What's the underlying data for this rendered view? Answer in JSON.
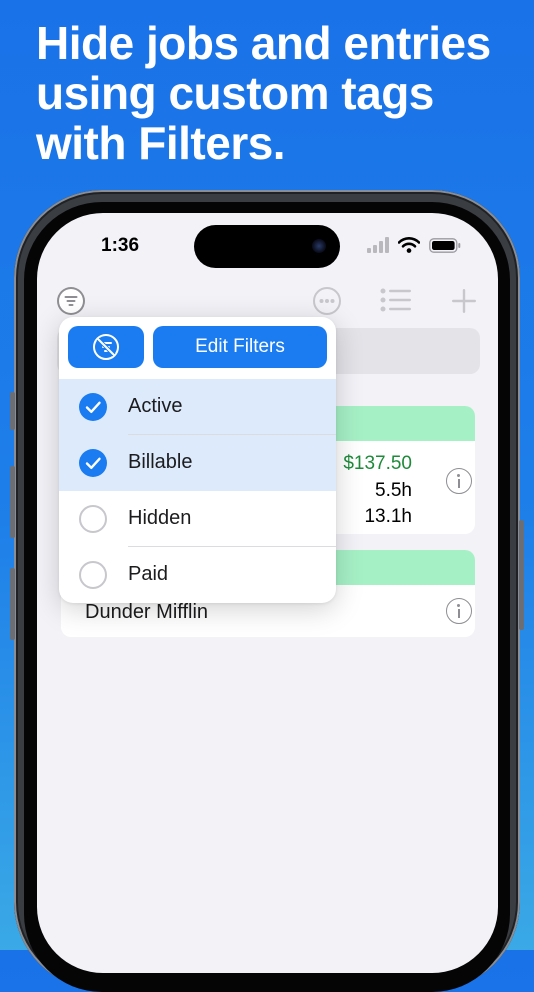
{
  "headline": {
    "line1": "Hide jobs and entries",
    "line2": "using custom tags",
    "line3": "with Filters."
  },
  "status_bar": {
    "time": "1:36",
    "icons": [
      "cellular-signal-icon",
      "wifi-icon",
      "battery-icon"
    ]
  },
  "toolbar": {
    "icons": [
      "filter-icon",
      "more-icon",
      "list-icon",
      "plus-icon"
    ]
  },
  "jobs": [
    {
      "amounts": [
        "$137.50",
        "5.5h",
        "13.1h"
      ]
    },
    {
      "client": "Dunder Mifflin"
    }
  ],
  "filter_menu": {
    "clear_icon": "clear-filter-icon",
    "edit_label": "Edit Filters",
    "items": [
      {
        "label": "Active",
        "checked": true
      },
      {
        "label": "Billable",
        "checked": true
      },
      {
        "label": "Hidden",
        "checked": false
      },
      {
        "label": "Paid",
        "checked": false
      }
    ]
  },
  "colors": {
    "background": "#1a72e8",
    "accent": "#1a7cf0",
    "header_green": "#a6f0c6",
    "amount_green": "#1e8a3a"
  }
}
